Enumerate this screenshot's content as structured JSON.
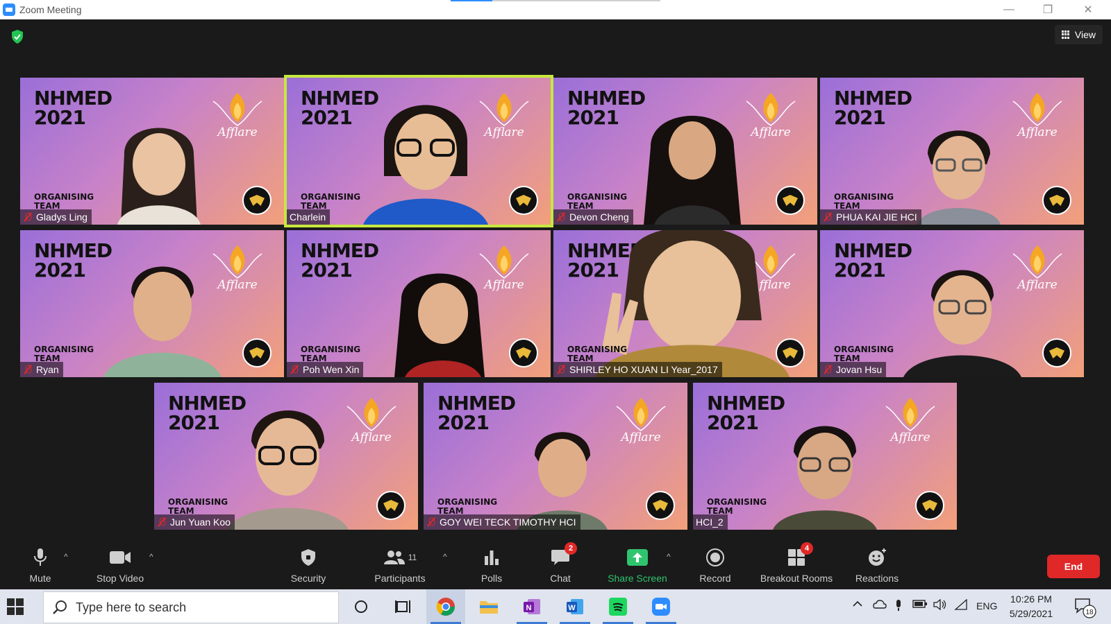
{
  "window": {
    "title": "Zoom Meeting",
    "minimize_label": "—",
    "restore_label": "❐",
    "close_label": "✕"
  },
  "meeting": {
    "view_label": "View",
    "tile_banner": {
      "event_line1": "NHMED",
      "event_line2": "2021",
      "org_line1": "ORGANISING",
      "org_line2": "TEAM",
      "logo_text": "Afflare"
    },
    "participants": [
      {
        "name": "Gladys Ling",
        "muted": true,
        "active": false
      },
      {
        "name": "Charlein",
        "muted": false,
        "active": true
      },
      {
        "name": "Devon Cheng",
        "muted": true,
        "active": false
      },
      {
        "name": "PHUA KAI JIE HCI",
        "muted": true,
        "active": false
      },
      {
        "name": "Ryan",
        "muted": true,
        "active": false
      },
      {
        "name": "Poh Wen Xin",
        "muted": true,
        "active": false
      },
      {
        "name": "SHIRLEY HO XUAN LI Year_2017",
        "muted": true,
        "active": false
      },
      {
        "name": "Jovan Hsu",
        "muted": true,
        "active": false
      },
      {
        "name": "Jun Yuan Koo",
        "muted": true,
        "active": false
      },
      {
        "name": "GOY WEI TECK TIMOTHY HCI",
        "muted": true,
        "active": false
      },
      {
        "name": "HCI_2",
        "muted": false,
        "active": false
      }
    ]
  },
  "toolbar": {
    "mute_label": "Mute",
    "stop_video_label": "Stop Video",
    "security_label": "Security",
    "participants_label": "Participants",
    "participants_count": "11",
    "polls_label": "Polls",
    "chat_label": "Chat",
    "chat_badge": "2",
    "share_screen_label": "Share Screen",
    "record_label": "Record",
    "breakout_rooms_label": "Breakout Rooms",
    "breakout_badge": "4",
    "reactions_label": "Reactions",
    "end_label": "End",
    "caret": "^"
  },
  "taskbar": {
    "search_placeholder": "Type here to search",
    "language": "ENG",
    "time": "10:26 PM",
    "date": "5/29/2021",
    "notification_count": "18"
  },
  "colors": {
    "active_speaker": "#c7e83f",
    "end_button": "#e02828",
    "share_screen": "#2fc56e",
    "security_shield": "#23c552",
    "zoom_blue": "#2d8cff"
  }
}
